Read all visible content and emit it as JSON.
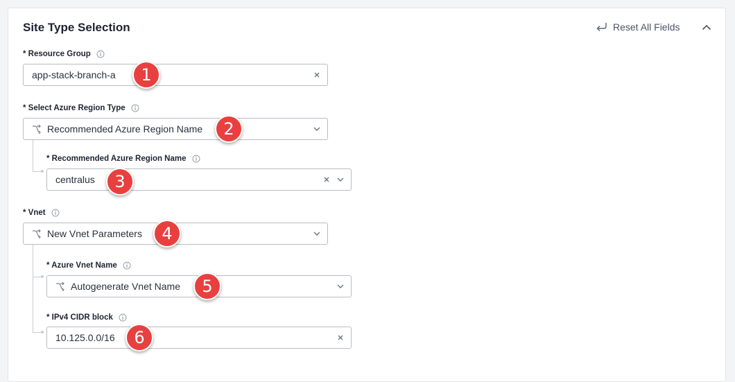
{
  "section": {
    "title": "Site Type Selection",
    "reset_label": "Reset All Fields"
  },
  "fields": {
    "resource_group": {
      "label": "* Resource Group",
      "value": "app-stack-branch-a",
      "badge": "1"
    },
    "region_type": {
      "label": "* Select Azure Region Type",
      "value": "Recommended Azure Region Name",
      "badge": "2"
    },
    "region_name": {
      "label": "* Recommended Azure Region Name",
      "value": "centralus",
      "badge": "3"
    },
    "vnet": {
      "label": "* Vnet",
      "value": "New Vnet Parameters",
      "badge": "4"
    },
    "vnet_name": {
      "label": "* Azure Vnet Name",
      "value": "Autogenerate Vnet Name",
      "badge": "5"
    },
    "cidr": {
      "label": "* IPv4 CIDR block",
      "value": "10.125.0.0/16",
      "badge": "6"
    }
  },
  "icons": {
    "info": "info-icon",
    "clear": "close-icon",
    "dropdown": "chevron-down-icon",
    "branch": "branch-icon",
    "reset": "undo-icon",
    "collapse": "chevron-up-icon"
  },
  "colors": {
    "badge": "#e8403f",
    "border": "#b9bcc4",
    "text": "#1e2333"
  }
}
